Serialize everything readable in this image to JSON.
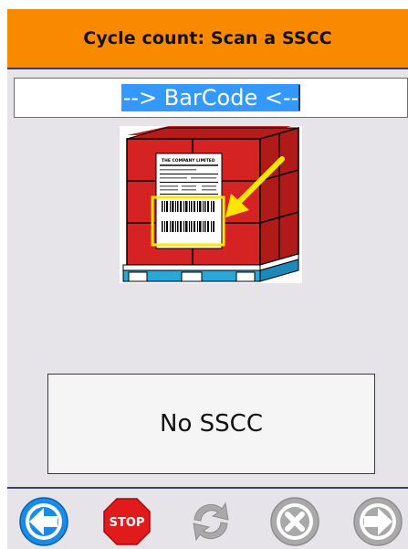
{
  "header": {
    "title": "Cycle count: Scan a SSCC"
  },
  "barcode_input": {
    "value": "--> BarCode <--"
  },
  "pallet_image": {
    "label_lines": [
      "THE COMPANY LIMITED"
    ]
  },
  "status": {
    "text": "No SSCC"
  },
  "toolbar": {
    "buttons": [
      {
        "icon": "back-arrow-icon",
        "enabled": true
      },
      {
        "icon": "stop-icon",
        "label": "STOP",
        "enabled": true
      },
      {
        "icon": "refresh-icon",
        "enabled": false
      },
      {
        "icon": "cancel-icon",
        "enabled": false
      },
      {
        "icon": "forward-arrow-icon",
        "enabled": false
      }
    ]
  },
  "colors": {
    "header_bg": "#f98a00",
    "selection": "#3399ff",
    "back_button": "#1a8ce8",
    "stop_button": "#e11b1b",
    "disabled_icon": "#a9a9a9"
  }
}
